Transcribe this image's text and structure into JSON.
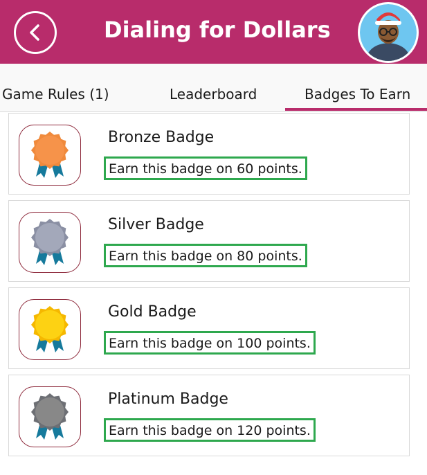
{
  "header": {
    "title": "Dialing for Dollars",
    "brand_color": "#b82c6b",
    "back_icon": "chevron-left-icon",
    "avatar_icon": "user-avatar"
  },
  "tabs": [
    {
      "label": "Game Rules (1)",
      "active": false
    },
    {
      "label": "Leaderboard",
      "active": false
    },
    {
      "label": "Badges To Earn",
      "active": true
    }
  ],
  "badges": [
    {
      "name": "Bronze Badge",
      "description": "Earn this badge on 60 points.",
      "color": "#f6934a",
      "edge": "#f08a3c"
    },
    {
      "name": "Silver Badge",
      "description": "Earn this badge on 80 points.",
      "color": "#a3a8ba",
      "edge": "#8a8fa3"
    },
    {
      "name": "Gold Badge",
      "description": "Earn this badge on 100 points.",
      "color": "#fdd213",
      "edge": "#f5b800"
    },
    {
      "name": "Platinum Badge",
      "description": "Earn this badge on 120 points.",
      "color": "#888888",
      "edge": "#6d6f74"
    }
  ],
  "colors": {
    "highlight_border": "#2ea84e",
    "ribbon": "#167a9c"
  }
}
